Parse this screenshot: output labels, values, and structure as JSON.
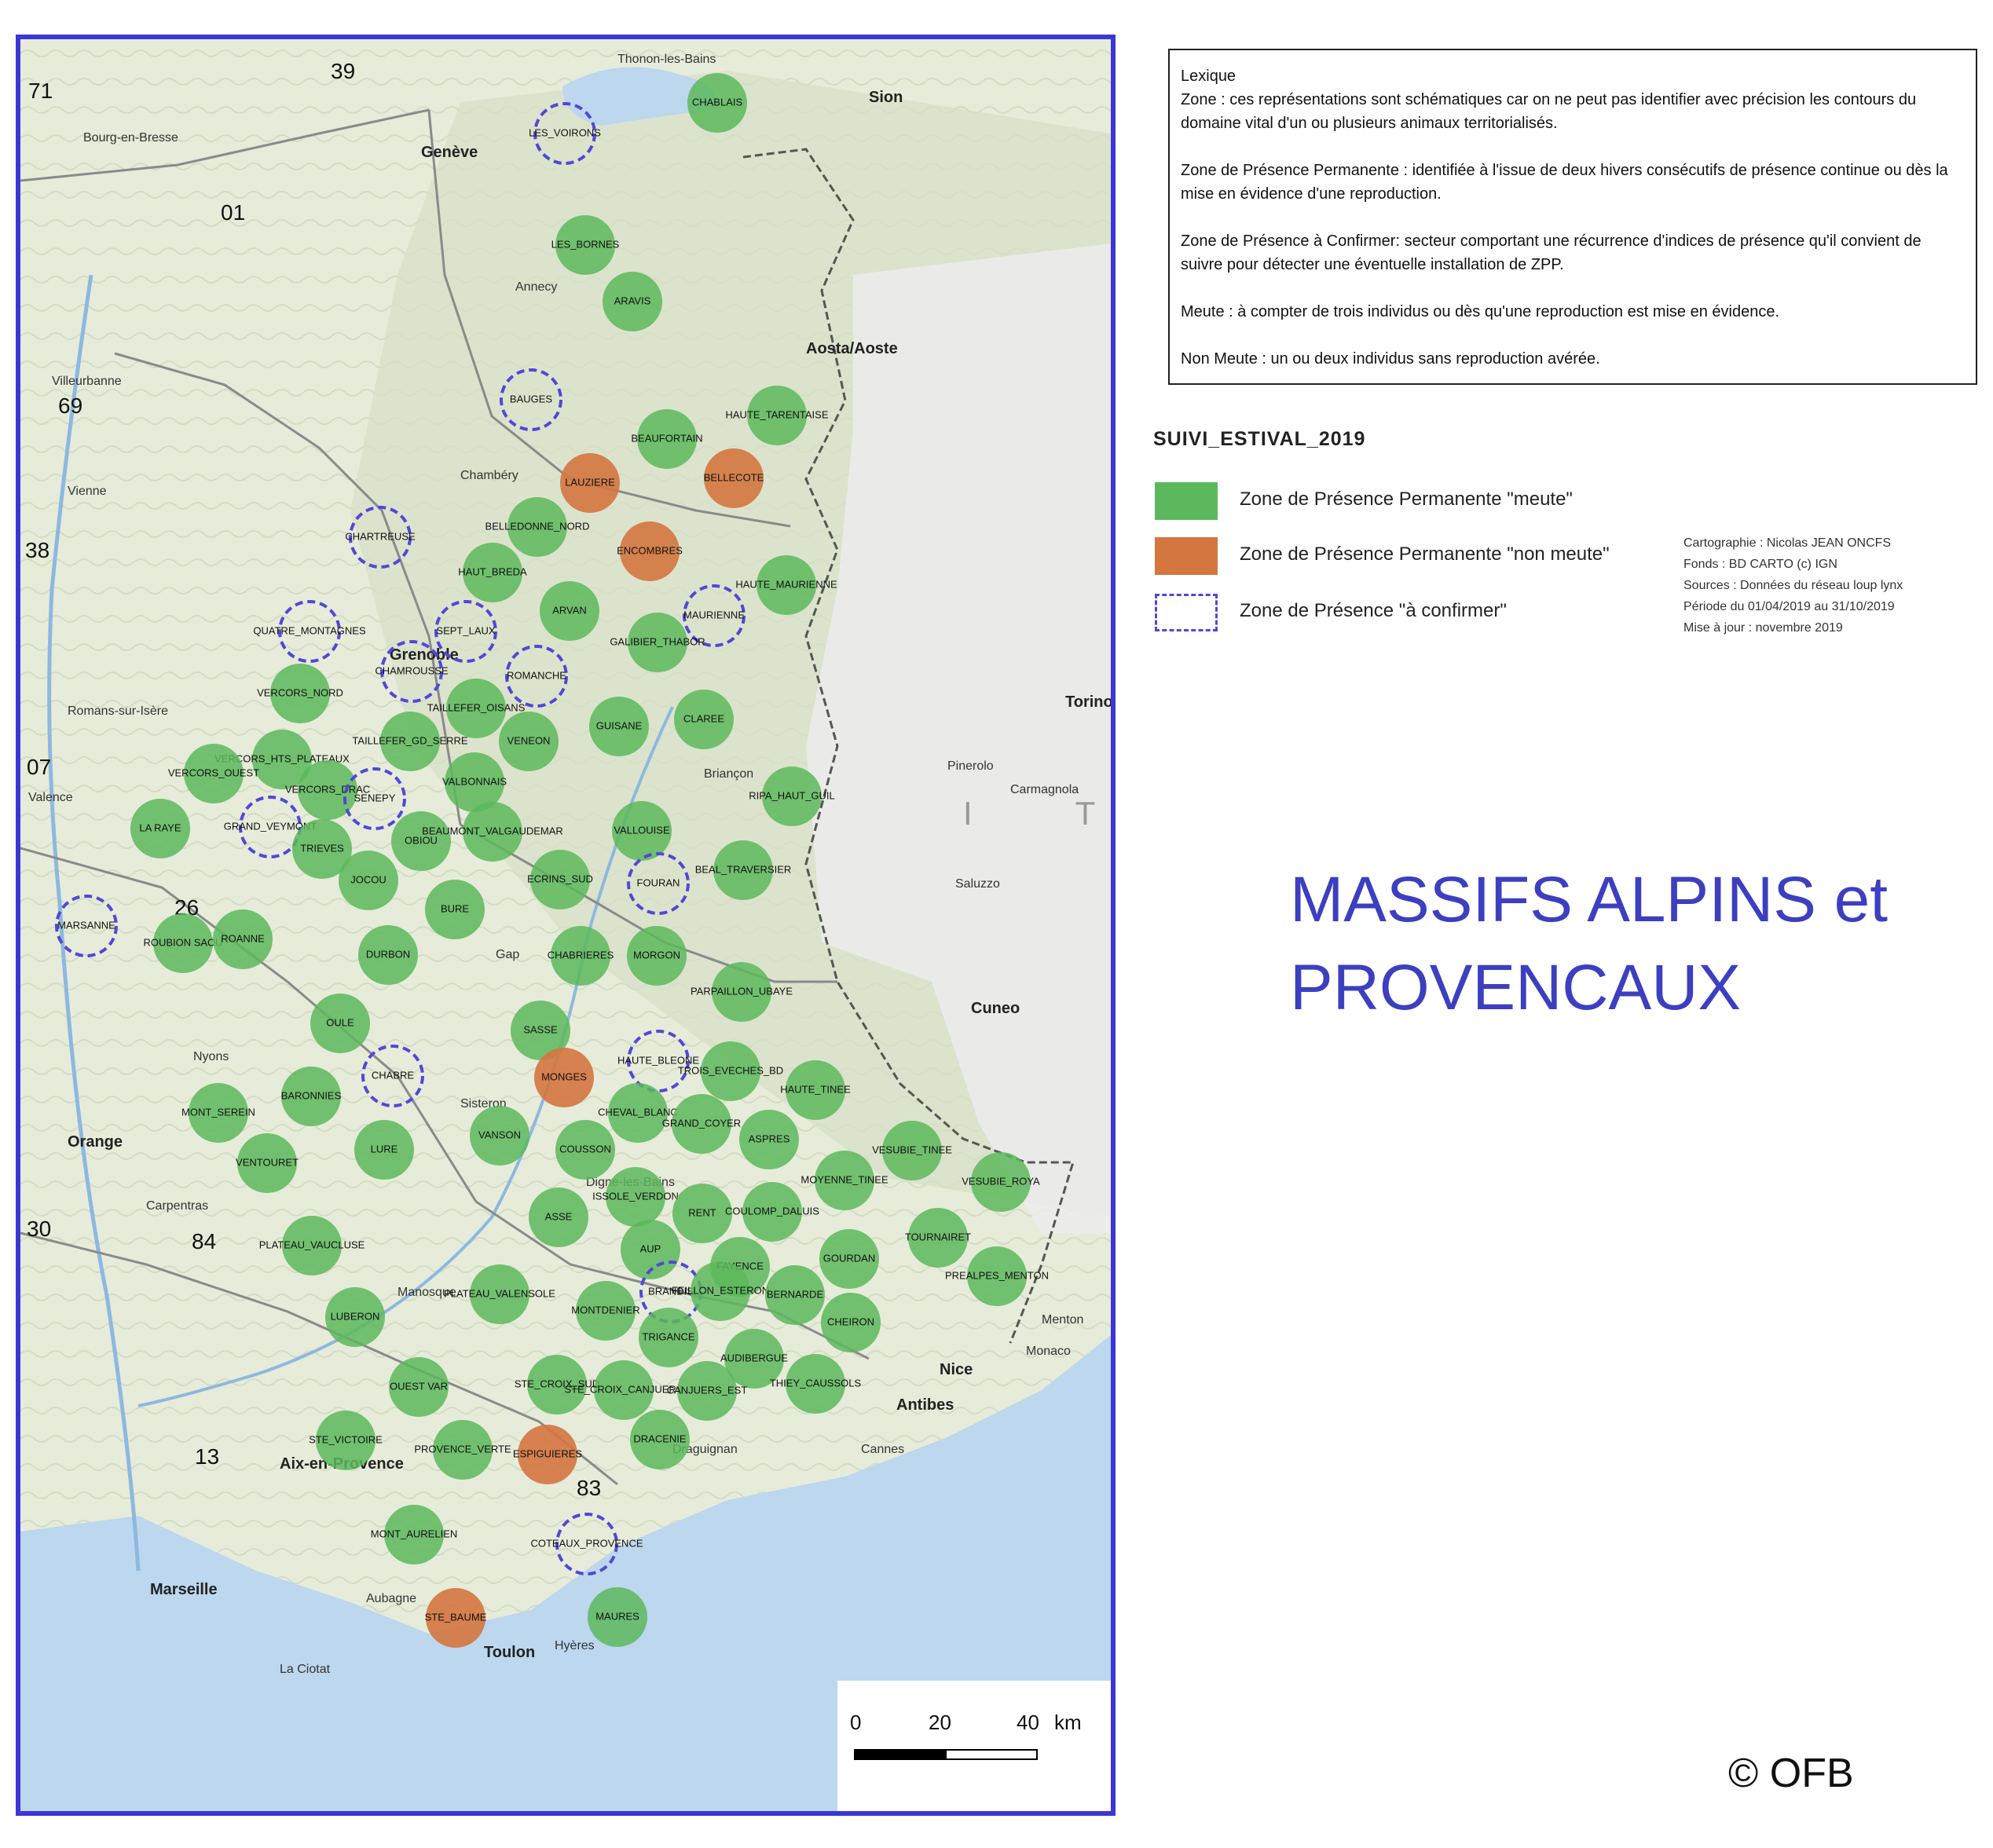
{
  "colors": {
    "frame": "#3c36d6",
    "permanent_meute": "#5cb85c",
    "permanent_non_meute": "#d4763f",
    "a_confirmer_stroke": "#5048d8",
    "title": "#3c3fc0",
    "sea": "#bcd7ee"
  },
  "lexique": {
    "title": "Lexique",
    "zone": "Zone : ces représentations sont schématiques car on ne peut pas identifier avec précision les contours du domaine vital d'un ou plusieurs animaux territorialisés.",
    "zpp": "Zone de Présence Permanente : identifiée à l'issue de deux hivers consécutifs de présence continue ou dès la mise en évidence d'une reproduction.",
    "zpc": "Zone de Présence à Confirmer: secteur comportant une récurrence d'indices de présence qu'il convient de suivre pour détecter une éventuelle installation de ZPP.",
    "meute": "Meute : à compter de trois individus ou dès qu'une reproduction est mise en évidence.",
    "non_meute": "Non Meute : un ou deux individus sans reproduction avérée."
  },
  "legend": {
    "title": "SUIVI_ESTIVAL_2019",
    "items": [
      {
        "label": "Zone de Présence Permanente \"meute\"",
        "type": "meute"
      },
      {
        "label": "Zone de Présence Permanente \"non meute\"",
        "type": "non_meute"
      },
      {
        "label": "Zone de Présence \"à confirmer\"",
        "type": "confirmer"
      }
    ]
  },
  "credits": {
    "cartographie": "Cartographie : Nicolas JEAN ONCFS",
    "fonds": "Fonds : BD CARTO (c) IGN",
    "sources": "Sources : Données du réseau loup lynx",
    "periode": "Période du 01/04/2019 au 31/10/2019",
    "maj": "Mise à jour : novembre 2019"
  },
  "title_line1": "MASSIFS ALPINS et",
  "title_line2": "PROVENCAUX",
  "copyright": "© OFB",
  "scale": {
    "labels": [
      "0",
      "20",
      "40"
    ],
    "unit": "km"
  },
  "departments": [
    "71",
    "39",
    "01",
    "69",
    "38",
    "07",
    "26",
    "30",
    "84",
    "13",
    "83"
  ],
  "places": [
    "Bourg-en-Bresse",
    "Villeurbanne",
    "Vienne",
    "Romans-sur-Isère",
    "Valence",
    "Orange",
    "Carpentras",
    "Nyons",
    "Marseille",
    "Aubagne",
    "La Ciotat",
    "Toulon",
    "Hyères",
    "Draguignan",
    "Cannes",
    "Antibes",
    "Nice",
    "Menton",
    "Monaco",
    "Grenoble",
    "Chambéry",
    "Annecy",
    "Genève",
    "Thonon-les-Bains",
    "Gap",
    "Briançon",
    "Digne-les-Bains",
    "Sisteron",
    "Manosque",
    "Aix-en-Provence",
    "Sion",
    "Aosta/Aoste",
    "Torino",
    "Cuneo",
    "Saluzzo",
    "Pinerolo",
    "Carmagnola"
  ],
  "italy_label": "I T A",
  "zones": [
    {
      "name": "CHABLAIS",
      "type": "meute"
    },
    {
      "name": "LES_VOIRONS",
      "type": "confirmer"
    },
    {
      "name": "LES_BORNES",
      "type": "meute"
    },
    {
      "name": "ARAVIS",
      "type": "meute"
    },
    {
      "name": "BAUGES",
      "type": "confirmer"
    },
    {
      "name": "HAUTE_TARENTAISE",
      "type": "meute"
    },
    {
      "name": "BEAUFORTAIN",
      "type": "meute"
    },
    {
      "name": "LAUZIERE",
      "type": "non_meute"
    },
    {
      "name": "BELLECOTE",
      "type": "non_meute"
    },
    {
      "name": "CHARTREUSE",
      "type": "confirmer"
    },
    {
      "name": "BELLEDONNE_NORD",
      "type": "meute"
    },
    {
      "name": "ENCOMBRES",
      "type": "non_meute"
    },
    {
      "name": "HAUT_BREDA",
      "type": "meute"
    },
    {
      "name": "HAUTE_MAURIENNE",
      "type": "meute"
    },
    {
      "name": "ARVAN",
      "type": "meute"
    },
    {
      "name": "MAURIENNE",
      "type": "confirmer"
    },
    {
      "name": "QUATRE_MONTAGNES",
      "type": "confirmer"
    },
    {
      "name": "SEPT_LAUX",
      "type": "confirmer"
    },
    {
      "name": "GALIBIER_THABOR",
      "type": "meute"
    },
    {
      "name": "CHAMROUSSE",
      "type": "confirmer"
    },
    {
      "name": "ROMANCHE",
      "type": "confirmer"
    },
    {
      "name": "VERCORS_NORD",
      "type": "meute"
    },
    {
      "name": "TAILLEFER_OISANS",
      "type": "meute"
    },
    {
      "name": "CLAREE",
      "type": "meute"
    },
    {
      "name": "GUISANE",
      "type": "meute"
    },
    {
      "name": "TAILLEFER_GD_SERRE",
      "type": "meute"
    },
    {
      "name": "VENEON",
      "type": "meute"
    },
    {
      "name": "VERCORS_HTS_PLATEAUX",
      "type": "meute"
    },
    {
      "name": "VERCORS_OUEST",
      "type": "meute"
    },
    {
      "name": "VALBONNAIS",
      "type": "meute"
    },
    {
      "name": "VERCORS_DRAC",
      "type": "meute"
    },
    {
      "name": "SENEPY",
      "type": "confirmer"
    },
    {
      "name": "RIPA_HAUT_GUIL",
      "type": "meute"
    },
    {
      "name": "LA RAYE",
      "type": "meute"
    },
    {
      "name": "GRAND_VEYMONT",
      "type": "confirmer"
    },
    {
      "name": "OBIOU",
      "type": "meute"
    },
    {
      "name": "BEAUMONT_VALGAUDEMAR",
      "type": "meute"
    },
    {
      "name": "VALLOUISE",
      "type": "meute"
    },
    {
      "name": "TRIEVES",
      "type": "meute"
    },
    {
      "name": "JOCOU",
      "type": "meute"
    },
    {
      "name": "ECRINS_SUD",
      "type": "meute"
    },
    {
      "name": "FOURAN",
      "type": "confirmer"
    },
    {
      "name": "BEAL_TRAVERSIER",
      "type": "meute"
    },
    {
      "name": "BURE",
      "type": "meute"
    },
    {
      "name": "MARSANNE",
      "type": "confirmer"
    },
    {
      "name": "ROUBION SAOU",
      "type": "meute"
    },
    {
      "name": "ROANNE",
      "type": "meute"
    },
    {
      "name": "DURBON",
      "type": "meute"
    },
    {
      "name": "CHABRIERES",
      "type": "meute"
    },
    {
      "name": "MORGON",
      "type": "meute"
    },
    {
      "name": "PARPAILLON_UBAYE",
      "type": "meute"
    },
    {
      "name": "OULE",
      "type": "meute"
    },
    {
      "name": "SASSE",
      "type": "meute"
    },
    {
      "name": "HAUTE_BLEONE",
      "type": "confirmer"
    },
    {
      "name": "CHABRE",
      "type": "confirmer"
    },
    {
      "name": "MONGES",
      "type": "non_meute"
    },
    {
      "name": "TROIS_EVECHES_BD",
      "type": "meute"
    },
    {
      "name": "HAUTE_TINEE",
      "type": "meute"
    },
    {
      "name": "BARONNIES",
      "type": "meute"
    },
    {
      "name": "MONT_SEREIN",
      "type": "meute"
    },
    {
      "name": "CHEVAL_BLANC",
      "type": "meute"
    },
    {
      "name": "GRAND_COYER",
      "type": "meute"
    },
    {
      "name": "VANSON",
      "type": "meute"
    },
    {
      "name": "ASPRES",
      "type": "meute"
    },
    {
      "name": "LURE",
      "type": "meute"
    },
    {
      "name": "VENTOURET",
      "type": "meute"
    },
    {
      "name": "COUSSON",
      "type": "meute"
    },
    {
      "name": "VESUBIE_TINEE",
      "type": "meute"
    },
    {
      "name": "MOYENNE_TINEE",
      "type": "meute"
    },
    {
      "name": "VESUBIE_ROYA",
      "type": "meute"
    },
    {
      "name": "ISSOLE_VERDON",
      "type": "meute"
    },
    {
      "name": "ASSE",
      "type": "meute"
    },
    {
      "name": "RENT",
      "type": "meute"
    },
    {
      "name": "COULOMP_DALUIS",
      "type": "meute"
    },
    {
      "name": "TOURNAIRET",
      "type": "meute"
    },
    {
      "name": "PLATEAU_VAUCLUSE",
      "type": "meute"
    },
    {
      "name": "GOURDAN",
      "type": "meute"
    },
    {
      "name": "AUP",
      "type": "meute"
    },
    {
      "name": "PREALPES_MENTON",
      "type": "meute"
    },
    {
      "name": "PLATEAU_VALENSOLE",
      "type": "meute"
    },
    {
      "name": "FAYENCE",
      "type": "meute"
    },
    {
      "name": "BRANDIS",
      "type": "confirmer"
    },
    {
      "name": "FEILLON_ESTERON",
      "type": "meute"
    },
    {
      "name": "BERNARDE",
      "type": "meute"
    },
    {
      "name": "LUBERON",
      "type": "meute"
    },
    {
      "name": "MONTDENIER",
      "type": "meute"
    },
    {
      "name": "CHEIRON",
      "type": "meute"
    },
    {
      "name": "TRIGANCE",
      "type": "meute"
    },
    {
      "name": "AUDIBERGUE",
      "type": "meute"
    },
    {
      "name": "THIEY_CAUSSOLS",
      "type": "meute"
    },
    {
      "name": "OUEST VAR",
      "type": "meute"
    },
    {
      "name": "STE_CROIX_SUD",
      "type": "meute"
    },
    {
      "name": "STE_CROIX_CANJUERS",
      "type": "meute"
    },
    {
      "name": "CANJUERS_EST",
      "type": "meute"
    },
    {
      "name": "STE_VICTOIRE",
      "type": "meute"
    },
    {
      "name": "PROVENCE_VERTE",
      "type": "meute"
    },
    {
      "name": "ESPIGUIERES",
      "type": "non_meute"
    },
    {
      "name": "DRACENIE",
      "type": "meute"
    },
    {
      "name": "MONT_AURELIEN",
      "type": "meute"
    },
    {
      "name": "COTEAUX_PROVENCE",
      "type": "confirmer"
    },
    {
      "name": "STE_BAUME",
      "type": "non_meute"
    },
    {
      "name": "MAURES",
      "type": "meute"
    }
  ]
}
